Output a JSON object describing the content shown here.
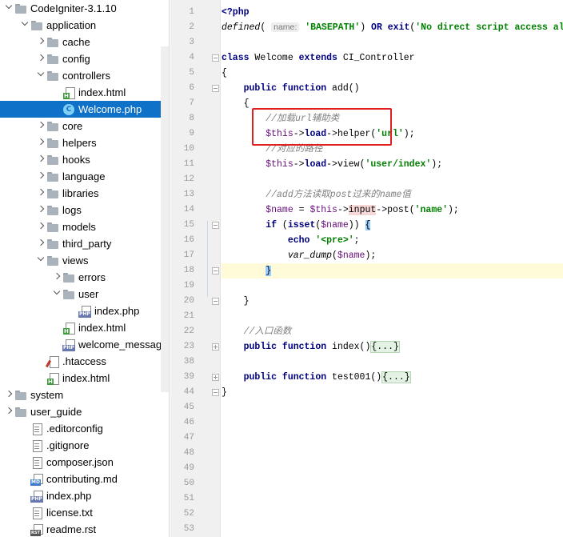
{
  "project_tree": {
    "selected_item": "Welcome.php",
    "items": [
      {
        "label": "CodeIgniter-3.1.10",
        "depth": 0,
        "type": "folder",
        "arrow": "down"
      },
      {
        "label": "application",
        "depth": 1,
        "type": "folder",
        "arrow": "down"
      },
      {
        "label": "cache",
        "depth": 2,
        "type": "folder",
        "arrow": "right"
      },
      {
        "label": "config",
        "depth": 2,
        "type": "folder",
        "arrow": "right"
      },
      {
        "label": "controllers",
        "depth": 2,
        "type": "folder",
        "arrow": "down"
      },
      {
        "label": "index.html",
        "depth": 3,
        "type": "html",
        "arrow": "none"
      },
      {
        "label": "Welcome.php",
        "depth": 3,
        "type": "class",
        "arrow": "none"
      },
      {
        "label": "core",
        "depth": 2,
        "type": "folder",
        "arrow": "right"
      },
      {
        "label": "helpers",
        "depth": 2,
        "type": "folder",
        "arrow": "right"
      },
      {
        "label": "hooks",
        "depth": 2,
        "type": "folder",
        "arrow": "right"
      },
      {
        "label": "language",
        "depth": 2,
        "type": "folder",
        "arrow": "right"
      },
      {
        "label": "libraries",
        "depth": 2,
        "type": "folder",
        "arrow": "right"
      },
      {
        "label": "logs",
        "depth": 2,
        "type": "folder",
        "arrow": "right"
      },
      {
        "label": "models",
        "depth": 2,
        "type": "folder",
        "arrow": "right"
      },
      {
        "label": "third_party",
        "depth": 2,
        "type": "folder",
        "arrow": "right"
      },
      {
        "label": "views",
        "depth": 2,
        "type": "folder",
        "arrow": "down"
      },
      {
        "label": "errors",
        "depth": 3,
        "type": "folder",
        "arrow": "right"
      },
      {
        "label": "user",
        "depth": 3,
        "type": "folder",
        "arrow": "down"
      },
      {
        "label": "index.php",
        "depth": 4,
        "type": "php",
        "arrow": "none"
      },
      {
        "label": "index.html",
        "depth": 3,
        "type": "html",
        "arrow": "none"
      },
      {
        "label": "welcome_message.php",
        "depth": 3,
        "type": "php",
        "arrow": "none"
      },
      {
        "label": ".htaccess",
        "depth": 2,
        "type": "ht",
        "arrow": "none"
      },
      {
        "label": "index.html",
        "depth": 2,
        "type": "html",
        "arrow": "none"
      },
      {
        "label": "system",
        "depth": 0,
        "type": "folder",
        "arrow": "right"
      },
      {
        "label": "user_guide",
        "depth": 0,
        "type": "folder",
        "arrow": "right"
      },
      {
        "label": ".editorconfig",
        "depth": 1,
        "type": "file",
        "arrow": "none"
      },
      {
        "label": ".gitignore",
        "depth": 1,
        "type": "file",
        "arrow": "none"
      },
      {
        "label": "composer.json",
        "depth": 1,
        "type": "file",
        "arrow": "none"
      },
      {
        "label": "contributing.md",
        "depth": 1,
        "type": "md",
        "arrow": "none"
      },
      {
        "label": "index.php",
        "depth": 1,
        "type": "php",
        "arrow": "none"
      },
      {
        "label": "license.txt",
        "depth": 1,
        "type": "file",
        "arrow": "none"
      },
      {
        "label": "readme.rst",
        "depth": 1,
        "type": "rst",
        "arrow": "none"
      }
    ]
  },
  "editor": {
    "current_line": "18",
    "parameter_hint": "name:",
    "lines": [
      {
        "n": "1",
        "code": [
          [
            "kw",
            "<?php"
          ]
        ]
      },
      {
        "n": "2",
        "code": [
          [
            "fn",
            "defined"
          ],
          [
            "",
            "( "
          ],
          [
            "hint",
            "name:"
          ],
          [
            "",
            " "
          ],
          [
            "str",
            "'BASEPATH'"
          ],
          [
            "",
            ") "
          ],
          [
            "kw",
            "OR"
          ],
          [
            "",
            " "
          ],
          [
            "kw",
            "exit"
          ],
          [
            "",
            "("
          ],
          [
            "str",
            "'No direct script access allowed'"
          ],
          [
            "",
            ");"
          ]
        ]
      },
      {
        "n": "3",
        "code": []
      },
      {
        "n": "4",
        "code": [
          [
            "kw",
            "class"
          ],
          [
            "",
            " Welcome "
          ],
          [
            "kw",
            "extends"
          ],
          [
            "",
            " CI_Controller"
          ]
        ]
      },
      {
        "n": "5",
        "code": [
          [
            "",
            "{"
          ]
        ]
      },
      {
        "n": "6",
        "code": [
          [
            "",
            "    "
          ],
          [
            "kw",
            "public function"
          ],
          [
            "",
            " add()"
          ]
        ]
      },
      {
        "n": "7",
        "code": [
          [
            "",
            "    {"
          ]
        ]
      },
      {
        "n": "8",
        "code": [
          [
            "",
            "        "
          ],
          [
            "com",
            "//加载url辅助类"
          ]
        ]
      },
      {
        "n": "9",
        "code": [
          [
            "",
            "        "
          ],
          [
            "var",
            "$this"
          ],
          [
            "",
            "->"
          ],
          [
            "kw",
            "load"
          ],
          [
            "",
            "->helper("
          ],
          [
            "str",
            "'url'"
          ],
          [
            "",
            ");"
          ]
        ]
      },
      {
        "n": "10",
        "code": [
          [
            "",
            "        "
          ],
          [
            "com",
            "//对应的路径"
          ]
        ]
      },
      {
        "n": "11",
        "code": [
          [
            "",
            "        "
          ],
          [
            "var",
            "$this"
          ],
          [
            "",
            "->"
          ],
          [
            "kw",
            "load"
          ],
          [
            "",
            "->view("
          ],
          [
            "str",
            "'user/index'"
          ],
          [
            "",
            ");"
          ]
        ]
      },
      {
        "n": "12",
        "code": []
      },
      {
        "n": "13",
        "code": [
          [
            "",
            "        "
          ],
          [
            "com",
            "//add方法读取post过来的name值"
          ]
        ]
      },
      {
        "n": "14",
        "code": [
          [
            "",
            "        "
          ],
          [
            "var",
            "$name"
          ],
          [
            "",
            " = "
          ],
          [
            "var",
            "$this"
          ],
          [
            "",
            "->"
          ],
          [
            "mhl",
            "input"
          ],
          [
            "",
            "->post("
          ],
          [
            "str",
            "'name'"
          ],
          [
            "",
            ");"
          ]
        ]
      },
      {
        "n": "15",
        "code": [
          [
            "",
            "        "
          ],
          [
            "kw",
            "if"
          ],
          [
            "",
            " ("
          ],
          [
            "kw",
            "isset"
          ],
          [
            "",
            "("
          ],
          [
            "var",
            "$name"
          ],
          [
            "",
            ")) "
          ],
          [
            "brace",
            "{"
          ]
        ]
      },
      {
        "n": "16",
        "code": [
          [
            "",
            "            "
          ],
          [
            "kw",
            "echo"
          ],
          [
            "",
            " "
          ],
          [
            "str",
            "'<pre>'"
          ],
          [
            "",
            ";"
          ]
        ]
      },
      {
        "n": "17",
        "code": [
          [
            "",
            "            "
          ],
          [
            "fn",
            "var_dump"
          ],
          [
            "",
            "("
          ],
          [
            "var",
            "$name"
          ],
          [
            "",
            ");"
          ]
        ]
      },
      {
        "n": "18",
        "code": [
          [
            "",
            "        "
          ],
          [
            "brace",
            "}"
          ]
        ]
      },
      {
        "n": "19",
        "code": []
      },
      {
        "n": "20",
        "code": [
          [
            "",
            "    }"
          ]
        ]
      },
      {
        "n": "21",
        "code": []
      },
      {
        "n": "22",
        "code": [
          [
            "",
            "    "
          ],
          [
            "com",
            "//入口函数"
          ]
        ]
      },
      {
        "n": "23",
        "code": [
          [
            "",
            "    "
          ],
          [
            "kw",
            "public function"
          ],
          [
            "",
            " index()"
          ],
          [
            "fold",
            "{...}"
          ]
        ]
      },
      {
        "n": "38",
        "code": []
      },
      {
        "n": "39",
        "code": [
          [
            "",
            "    "
          ],
          [
            "kw",
            "public function"
          ],
          [
            "",
            " test001()"
          ],
          [
            "fold",
            "{...}"
          ]
        ]
      },
      {
        "n": "44",
        "code": [
          [
            "",
            "}"
          ]
        ]
      },
      {
        "n": "45",
        "code": []
      },
      {
        "n": "46",
        "code": []
      },
      {
        "n": "47",
        "code": []
      },
      {
        "n": "48",
        "code": []
      },
      {
        "n": "49",
        "code": []
      },
      {
        "n": "50",
        "code": []
      },
      {
        "n": "51",
        "code": []
      },
      {
        "n": "52",
        "code": []
      },
      {
        "n": "53",
        "code": []
      }
    ]
  }
}
